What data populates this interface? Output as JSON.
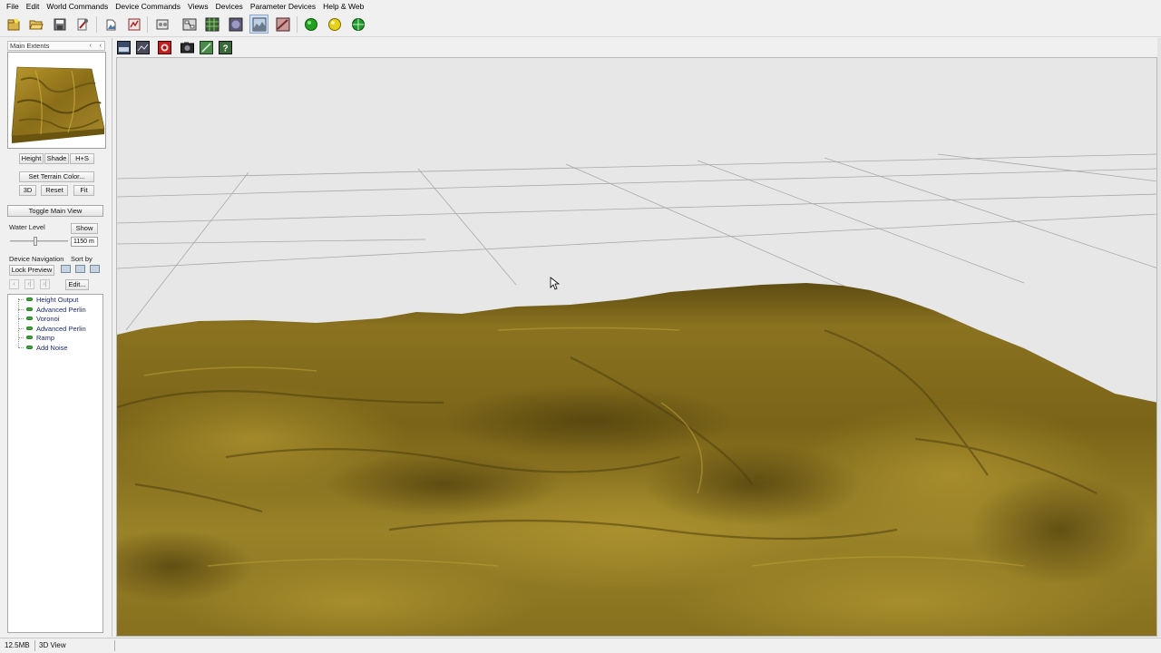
{
  "menu": {
    "items": [
      "File",
      "Edit",
      "World Commands",
      "Device Commands",
      "Views",
      "Devices",
      "Parameter Devices",
      "Help & Web"
    ]
  },
  "toolbar": {
    "buttons": [
      {
        "icon": "new-world-icon"
      },
      {
        "icon": "open-folder-icon"
      },
      {
        "icon": "save-disk-icon"
      },
      {
        "icon": "wrench-settings-icon"
      },
      {
        "icon": "world-properties-icon"
      },
      {
        "icon": "build-report-icon"
      },
      {
        "icon": "device-palette-icon"
      },
      {
        "icon": "layout-view-icon"
      },
      {
        "icon": "grid-view-icon"
      },
      {
        "icon": "preview-3d-icon"
      },
      {
        "icon": "terrain-view-icon",
        "pressed": true
      },
      {
        "icon": "render-view-icon"
      },
      {
        "icon": "green-build-icon"
      },
      {
        "icon": "yellow-build-icon"
      },
      {
        "icon": "globe-build-icon"
      }
    ]
  },
  "left_panel": {
    "main_extents_label": "Main Extents",
    "preview_buttons": {
      "height": "Height",
      "shade": "Shade",
      "hs": "H+S"
    },
    "set_terrain_color": "Set Terrain Color...",
    "view_buttons": {
      "three_d": "3D",
      "reset": "Reset",
      "fit": "Fit"
    },
    "toggle_main_view": "Toggle Main View",
    "water_level_label": "Water Level",
    "water_show": "Show",
    "water_value": "1150 m",
    "device_navigation_label": "Device Navigation",
    "sort_by_label": "Sort by",
    "lock_preview": "Lock Preview",
    "nav_first": "‹",
    "nav_prev": "‹|",
    "nav_next": "›|",
    "edit_button": "Edit...",
    "tree_items": [
      "Height Output",
      "Advanced Perlin",
      "Voronoi",
      "Advanced Perlin",
      "Ramp",
      "Add Noise"
    ]
  },
  "viewport_toolbar": {
    "buttons": [
      {
        "icon": "display-mode-icon"
      },
      {
        "icon": "camera-settings-icon"
      },
      {
        "icon": "render-red-icon"
      },
      {
        "icon": "snapshot-camera-icon"
      },
      {
        "icon": "edit-line-icon"
      },
      {
        "icon": "help-icon"
      }
    ]
  },
  "viewport": {
    "background": "#e7e7e7",
    "grid_color": "#a8a8a8",
    "terrain_colors": [
      "#6e5c13",
      "#8a7420",
      "#a88e2c",
      "#574812"
    ]
  },
  "statusbar": {
    "memory": "12.5MB",
    "view": "3D View"
  }
}
